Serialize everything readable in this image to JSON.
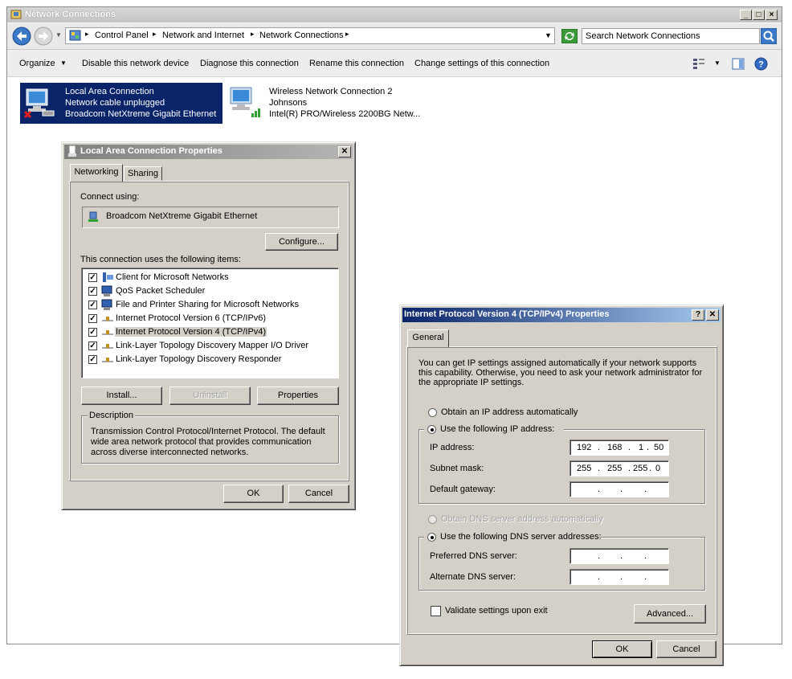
{
  "window": {
    "title": "Network Connections",
    "breadcrumb": [
      "Control Panel",
      "Network and Internet",
      "Network Connections"
    ],
    "search_placeholder": "Search Network Connections"
  },
  "toolbar": {
    "organize": "Organize",
    "disable": "Disable this network device",
    "diagnose": "Diagnose this connection",
    "rename": "Rename this connection",
    "change": "Change settings of this connection"
  },
  "connections": [
    {
      "name": "Local Area Connection",
      "status": "Network cable unplugged",
      "adapter": "Broadcom NetXtreme Gigabit Ethernet"
    },
    {
      "name": "Wireless Network Connection 2",
      "status": "Johnsons",
      "adapter": "Intel(R) PRO/Wireless 2200BG Netw..."
    }
  ],
  "lac_dialog": {
    "title": "Local Area Connection Properties",
    "tabs": [
      "Networking",
      "Sharing"
    ],
    "connect_using_label": "Connect using:",
    "adapter": "Broadcom NetXtreme Gigabit Ethernet",
    "configure": "Configure...",
    "items_label": "This connection uses the following items:",
    "items": [
      "Client for Microsoft Networks",
      "QoS Packet Scheduler",
      "File and Printer Sharing for Microsoft Networks",
      "Internet Protocol Version 6 (TCP/IPv6)",
      "Internet Protocol Version 4 (TCP/IPv4)",
      "Link-Layer Topology Discovery Mapper I/O Driver",
      "Link-Layer Topology Discovery Responder"
    ],
    "install": "Install...",
    "uninstall": "Uninstall",
    "properties": "Properties",
    "description_label": "Description",
    "description": "Transmission Control Protocol/Internet Protocol. The default wide area network protocol that provides communication across diverse interconnected networks.",
    "ok": "OK",
    "cancel": "Cancel"
  },
  "ipv4_dialog": {
    "title": "Internet Protocol Version 4 (TCP/IPv4) Properties",
    "tab": "General",
    "intro": "You can get IP settings assigned automatically if your network supports this capability. Otherwise, you need to ask your network administrator for the appropriate IP settings.",
    "obtain_ip": "Obtain an IP address automatically",
    "use_ip": "Use the following IP address:",
    "ip_label": "IP address:",
    "ip": [
      "192",
      "168",
      "1",
      "50"
    ],
    "subnet_label": "Subnet mask:",
    "subnet": [
      "255",
      "255",
      "255",
      "0"
    ],
    "gateway_label": "Default gateway:",
    "obtain_dns": "Obtain DNS server address automatically",
    "use_dns": "Use the following DNS server addresses:",
    "preferred_label": "Preferred DNS server:",
    "alternate_label": "Alternate DNS server:",
    "validate": "Validate settings upon exit",
    "advanced": "Advanced...",
    "ok": "OK",
    "cancel": "Cancel"
  }
}
